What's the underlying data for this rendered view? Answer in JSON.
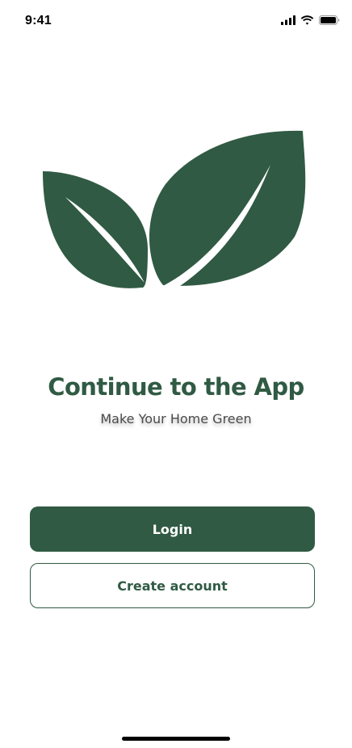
{
  "status_bar": {
    "time": "9:41",
    "icons": [
      "cellular-signal-icon",
      "wifi-icon",
      "battery-icon"
    ]
  },
  "logo": {
    "name": "leaf-logo",
    "color": "#305a43"
  },
  "main": {
    "title": "Continue to the App",
    "subtitle": "Make Your Home Green"
  },
  "actions": {
    "login_label": "Login",
    "create_account_label": "Create account"
  },
  "colors": {
    "brand": "#305a43",
    "background": "#ffffff"
  }
}
